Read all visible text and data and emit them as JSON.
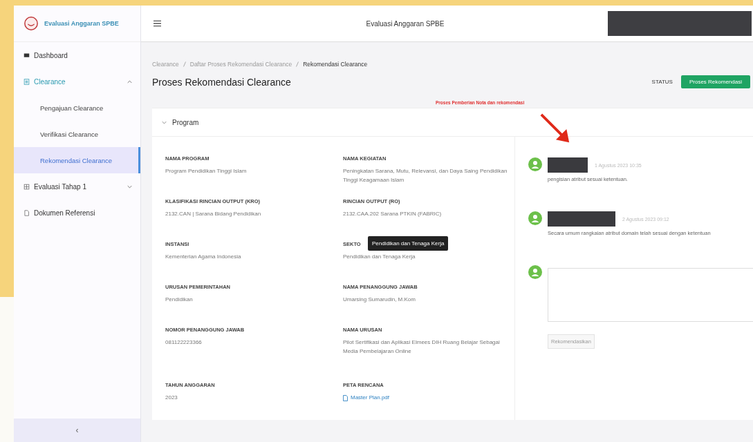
{
  "sidebar": {
    "brand": "Evaluasi Anggaran SPBE",
    "items": [
      {
        "label": "Dashboard"
      },
      {
        "label": "Clearance",
        "expanded": true,
        "children": [
          {
            "label": "Pengajuan Clearance",
            "selected": false
          },
          {
            "label": "Verifikasi Clearance",
            "selected": false
          },
          {
            "label": "Rekomendasi Clearance",
            "selected": true
          }
        ]
      },
      {
        "label": "Evaluasi Tahap 1",
        "expanded": false
      },
      {
        "label": "Dokumen Referensi"
      }
    ],
    "collapse_button": "‹"
  },
  "header": {
    "title": "Evaluasi Anggaran SPBE"
  },
  "breadcrumb": [
    "Clearance",
    "Daftar Proses Rekomendasi Clearance",
    "Rekomendasi Clearance"
  ],
  "page_title": "Proses Rekomendasi Clearance",
  "status": {
    "label": "STATUS",
    "value": "Proses Rekomendasi"
  },
  "annotation": "Proses Pemberian Nota dan rekomendasi",
  "section": {
    "title": "Program",
    "expanded": true,
    "fields": [
      {
        "label": "NAMA PROGRAM",
        "value": "Program Pendidikan Tinggi Islam",
        "kind": "text"
      },
      {
        "label": "NAMA KEGIATAN",
        "value": "Peningkatan Sarana, Mutu, Relevansi, dan Daya Saing Pendidikan Tinggi Keagamaan Islam",
        "kind": "text"
      },
      {
        "label": "KLASIFIKASI RINCIAN OUTPUT (KRO)",
        "value": "2132.CAN | Sarana Bidang Pendidikan",
        "kind": "text"
      },
      {
        "label": "RINCIAN OUTPUT (RO)",
        "value": "2132.CAA.202 Sarana PTKIN (FABRIC)",
        "kind": "text"
      },
      {
        "label": "INSTANSI",
        "value": "Kementerian Agama Indonesia",
        "kind": "text"
      },
      {
        "label": "SEKTO",
        "value": "Pendidikan dan Tenaga Kerja",
        "kind": "text",
        "tooltip": "Pendidikan dan Tenaga Kerja"
      },
      {
        "label": "URUSAN PEMERINTAHAN",
        "value": "Pendidikan",
        "kind": "text"
      },
      {
        "label": "NAMA PENANGGUNG JAWAB",
        "value": "Umarsing Sumarudin, M.Kom",
        "kind": "text"
      },
      {
        "label": "NOMOR PENANGGUNG JAWAB",
        "value": "081122223366",
        "kind": "text"
      },
      {
        "label": "NAMA URUSAN",
        "value": "Pilot Sertifikasi dan Aplikasi Elmees DIH Ruang Belajar Sebagai Media Pembelajaran Online",
        "kind": "text"
      },
      {
        "label": "TAHUN ANGGARAN",
        "value": "2023",
        "kind": "text"
      },
      {
        "label": "PETA RENCANA",
        "value": "Master Plan.pdf",
        "kind": "file"
      }
    ]
  },
  "comments": [
    {
      "time": "1 Agustus 2023 10:35",
      "text": "pengisian atribut sesuai ketentuan."
    },
    {
      "time": "2 Agustus 2023 09:12",
      "text": "Secara umum rangkaian atribut domain telah sesuai dengan ketentuan"
    }
  ],
  "comment_form": {
    "button": "Rekomendasikan"
  }
}
